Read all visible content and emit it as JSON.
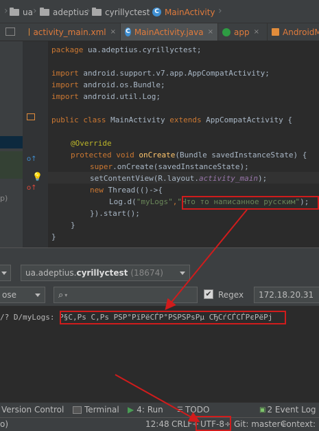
{
  "breadcrumb": {
    "items": [
      "ua",
      "adeptius",
      "cyrillyctest",
      "MainActivity"
    ]
  },
  "tabs": [
    {
      "label": "activity_main.xml",
      "close": "×"
    },
    {
      "label": "MainActivity.java",
      "close": "×"
    },
    {
      "label": "app",
      "close": "×"
    },
    {
      "label": "AndroidM"
    }
  ],
  "code": {
    "line1_kw": "package",
    "line1_rest": " ua.adeptius.cyrillyctest;",
    "line2_kw": "import",
    "line2_rest": " android.support.v7.app.AppCompatActivity;",
    "line3_kw": "import",
    "line3_rest": " android.os.Bundle;",
    "line4_kw": "import",
    "line4_rest": " android.util.Log;",
    "line5_kw1": "public class",
    "line5_mid": " MainActivity ",
    "line5_kw2": "extends",
    "line5_rest": " AppCompatActivity {",
    "line6_ann": "@Override",
    "line7_kw": "protected void",
    "line7_fn": " onCreate",
    "line7_rest": "(Bundle savedInstanceState) {",
    "line8_kw": "super",
    "line8_rest": ".onCreate(savedInstanceState);",
    "line9_pre": "setContentView(R.layout.",
    "line9_fld": "activity_main",
    "line9_post": ");",
    "line10_kw": "new",
    "line10_rest": " Thread(()->{",
    "line11_pre": "Log.d(",
    "line11_str": "\"myLogs\"",
    "line11_comma": ",",
    "line11_str2": "\"Что то написанное русским\"",
    "line11_post": ");",
    "line12": "}).start();",
    "line13": "}",
    "line14": "}"
  },
  "logcat": {
    "process": "ua.adeptius.",
    "process_bold": "cyrillyctest",
    "pid": "(18674)",
    "level": "ose",
    "search_placeholder": "",
    "regex_label": "Regex",
    "ip": "172.18.20.31",
    "log_prefix": "/? D/myLogs: ",
    "log_message": "Р§С‚Рѕ С‚Рѕ РЅР°РїРёСЃР°РЅРЅРѕРµ СЂСѓСЃСЃРєРёРј"
  },
  "toolwindows": {
    "version_control": "Version Control",
    "terminal": "Terminal",
    "run": "4: Run",
    "todo": "TODO",
    "event_log": "2 Event Log"
  },
  "statusbar": {
    "left": "o)",
    "position": "12:48",
    "line_sep": "CRLF÷",
    "encoding": "UTF-8÷",
    "git": "Git: master÷",
    "context": "Context: <"
  },
  "left_panel": {
    "text": "p)"
  },
  "colors": {
    "annotation_red": "#d01c1c",
    "background": "#2b2b2b",
    "panel": "#3c3f41"
  }
}
